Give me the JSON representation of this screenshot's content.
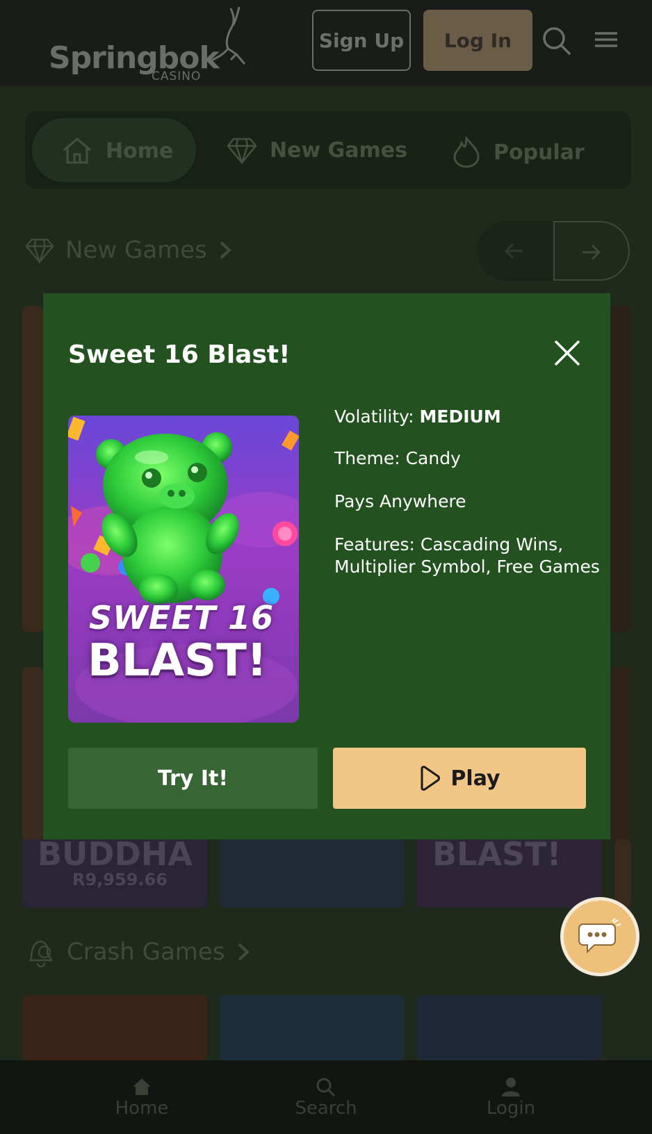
{
  "header": {
    "logo_text": "Springbok",
    "logo_subtext": "CASINO",
    "signup_label": "Sign Up",
    "login_label": "Log In"
  },
  "categories": [
    {
      "label": "Home",
      "icon": "home-icon"
    },
    {
      "label": "New Games",
      "icon": "diamond-icon"
    },
    {
      "label": "Popular",
      "icon": "flame-icon"
    }
  ],
  "sections": {
    "new_games": "New Games",
    "crash_games": "Crash Games"
  },
  "background_cards": {
    "card1_title": "BUDDHA",
    "card1_amount": "R9,959.66",
    "card3_title": "BLAST!"
  },
  "modal": {
    "title": "Sweet 16 Blast!",
    "art_line1": "SWEET 16",
    "art_line2": "BLAST!",
    "volatility_label": "Volatility:",
    "volatility_value": "MEDIUM",
    "theme": "Theme: Candy",
    "pays": "Pays Anywhere",
    "features_line1": "Features: Cascading Wins,",
    "features_line2": "Multiplier Symbol, Free Games",
    "try_label": "Try It!",
    "play_label": "Play"
  },
  "bottom_nav": [
    {
      "label": "Home",
      "icon": "home-icon"
    },
    {
      "label": "Search",
      "icon": "search-icon"
    },
    {
      "label": "Login",
      "icon": "user-icon"
    }
  ],
  "colors": {
    "modal_bg": "#235220",
    "play_button": "#f2c686",
    "try_button": "#376634",
    "chat_fab": "#efc07a"
  }
}
